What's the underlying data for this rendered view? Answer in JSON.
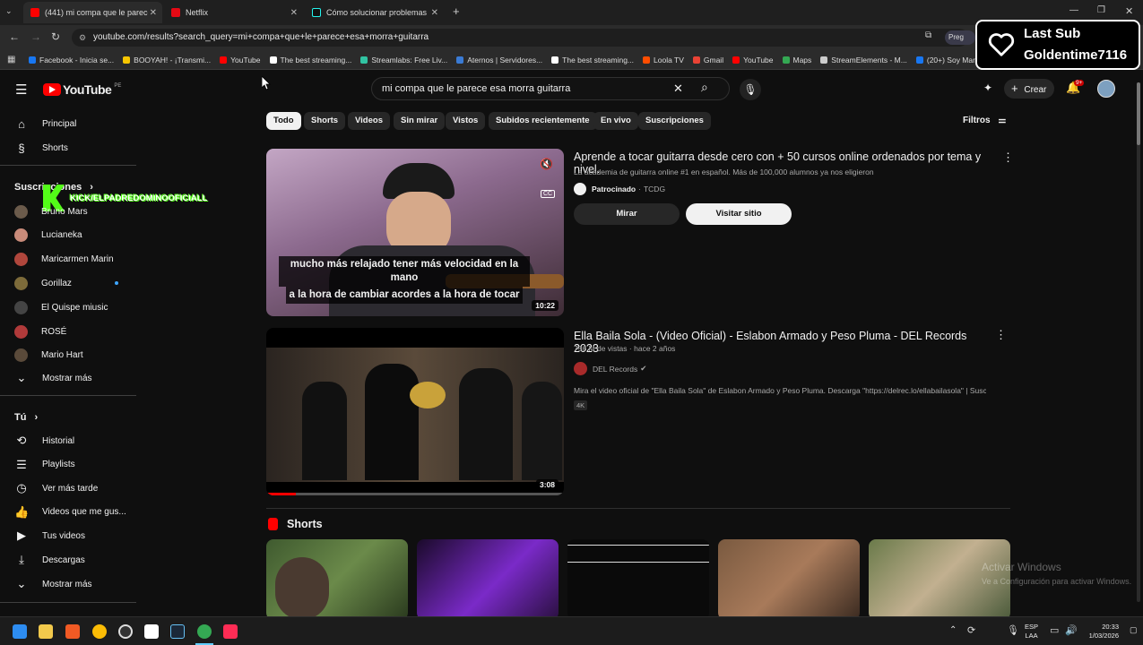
{
  "browser": {
    "tabs": [
      {
        "label": "(441) mi compa que le parece",
        "color": "#ff0000",
        "active": true
      },
      {
        "label": "Netflix",
        "color": "#e50914",
        "active": false
      },
      {
        "label": "Cómo solucionar problemas de",
        "color": "#25f4ee",
        "active": false
      }
    ],
    "new_tab": "+",
    "url": "youtube.com/results?search_query=mi+compa+que+le+parece+esa+morra+guitarra",
    "bookmarks": [
      {
        "label": "Facebook - Inicia se...",
        "color": "#1877f2"
      },
      {
        "label": "BOOYAH! - ¡Transmi...",
        "color": "#f7c600"
      },
      {
        "label": "YouTube",
        "color": "#ff0000"
      },
      {
        "label": "The best streaming...",
        "color": "#ffffff"
      },
      {
        "label": "Streamlabs: Free Liv...",
        "color": "#31c3a2"
      },
      {
        "label": "Aternos | Servidores...",
        "color": "#3a7bd5"
      },
      {
        "label": "The best streaming...",
        "color": "#ffffff"
      },
      {
        "label": "Loola TV",
        "color": "#ff4d00"
      },
      {
        "label": "Gmail",
        "color": "#ea4335"
      },
      {
        "label": "YouTube",
        "color": "#ff0000"
      },
      {
        "label": "Maps",
        "color": "#34a853"
      },
      {
        "label": "StreamElements - M...",
        "color": "#cccccc"
      },
      {
        "label": "(20+) Soy Marily",
        "color": "#1877f2"
      }
    ]
  },
  "overlay": {
    "line1": "Last Sub",
    "line2": "Goldentime7116"
  },
  "youtube": {
    "logo": "YouTube",
    "logo_region": "PE",
    "search_value": "mi compa que le parece esa morra guitarra",
    "create_label": "Crear",
    "notif_badge": "9+",
    "sidebar": {
      "main": [
        {
          "label": "Principal",
          "icon": "home-icon"
        },
        {
          "label": "Shorts",
          "icon": "shorts-icon"
        }
      ],
      "subs_header": "Suscripciones",
      "subs_overlay": "KICK/ELPADREDOMINOOFICIALL",
      "subs": [
        {
          "label": "Bruno Mars",
          "color": "#6b5b4b",
          "dot": false
        },
        {
          "label": "Lucianeka",
          "color": "#c98b7a",
          "dot": false
        },
        {
          "label": "Maricarmen Marin",
          "color": "#b0463c",
          "dot": false
        },
        {
          "label": "Gorillaz",
          "color": "#7d6b3a",
          "dot": true
        },
        {
          "label": "El Quispe miusic",
          "color": "#444444",
          "dot": false
        },
        {
          "label": "ROSÉ",
          "color": "#b03a3a",
          "dot": false
        },
        {
          "label": "Mario Hart",
          "color": "#5a4a3a",
          "dot": false
        }
      ],
      "show_more": "Mostrar más",
      "you_header": "Tú",
      "you": [
        {
          "label": "Historial",
          "icon": "history-icon"
        },
        {
          "label": "Playlists",
          "icon": "playlists-icon"
        },
        {
          "label": "Ver más tarde",
          "icon": "watch-later-icon"
        },
        {
          "label": "Videos que me gus...",
          "icon": "like-icon"
        },
        {
          "label": "Tus videos",
          "icon": "your-videos-icon"
        },
        {
          "label": "Descargas",
          "icon": "downloads-icon"
        }
      ],
      "show_more_2": "Mostrar más"
    },
    "chips": [
      "Todo",
      "Shorts",
      "Videos",
      "Sin mirar",
      "Vistos",
      "Subidos recientemente",
      "En vivo",
      "Suscripciones"
    ],
    "filters": "Filtros",
    "ad": {
      "title": "Aprende a tocar guitarra desde cero con + 50 cursos online ordenados por tema y nivel.",
      "description": "La academia de guitarra online #1 en español. Más de 100,000 alumnos ya nos eligieron",
      "sponsored": "Patrocinado",
      "channel": "TCDG",
      "watch": "Mirar",
      "visit": "Visitar sitio",
      "caption_line1": "mucho más relajado tener más velocidad en la mano",
      "caption_line2": "a la hora de cambiar acordes a la hora de tocar",
      "duration": "10:22",
      "cc": "CC"
    },
    "video": {
      "title": "Ella Baila Sola - (Video Oficial) - Eslabon Armado y Peso Pluma - DEL Records 2023",
      "views": "756 M de vistas",
      "age": "hace 2 años",
      "channel": "DEL Records",
      "description": "Mira el video oficial de \"Ella Baila Sola\" de Eslabon Armado y Peso Pluma. Descarga \"https://delrec.lo/ellabailasola\" | Suscribete ...",
      "badge": "4K",
      "duration": "3:08",
      "progress": 0.1
    },
    "shorts_header": "Shorts"
  },
  "watermark": {
    "line1": "Activar Windows",
    "line2": "Ve a Configuración para activar Windows."
  },
  "taskbar": {
    "lang": "ESP",
    "region": "LAA",
    "time": "20:33",
    "date": "1/03/2026"
  }
}
